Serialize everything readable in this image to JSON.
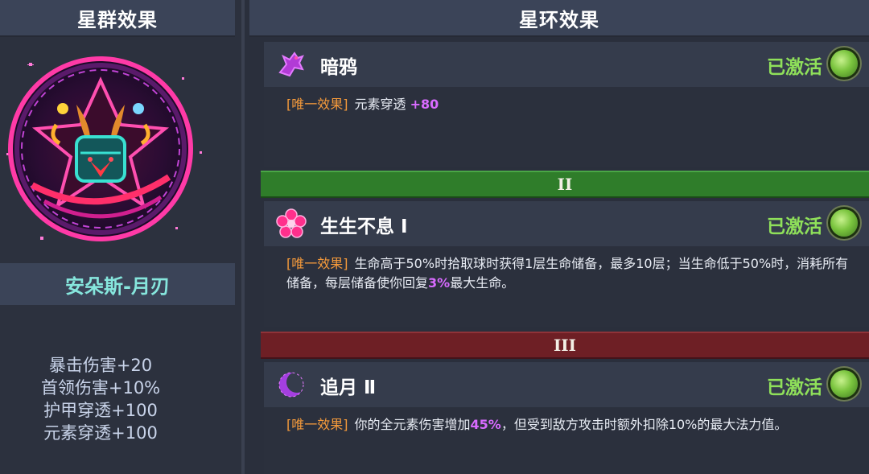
{
  "left_panel": {
    "header": "星群效果",
    "constellation_name": "安朵斯-月刃",
    "stats": [
      "暴击伤害+20",
      "首领伤害+10%",
      "护甲穿透+100",
      "元素穿透+100"
    ]
  },
  "right_panel": {
    "header": "星环效果",
    "entries": [
      {
        "icon": "crow-icon",
        "title": "暗鸦",
        "status": "已激活",
        "tag": "[唯一效果]",
        "desc_pre": "元素穿透",
        "highlight": "+80",
        "desc_post": ""
      },
      {
        "icon": "flower-icon",
        "title": "生生不息 Ⅰ",
        "status": "已激活",
        "tag": "[唯一效果]",
        "desc_pre": "生命高于50%时拾取球时获得1层生命储备，最多10层；当生命低于50%时，消耗所有储备，每层储备使你回复",
        "highlight": "3%",
        "desc_post": "最大生命。"
      },
      {
        "icon": "crescent-moon-icon",
        "title": "追月 Ⅱ",
        "status": "已激活",
        "tag": "[唯一效果]",
        "desc_pre": "你的全元素伤害增加",
        "highlight": "45%",
        "desc_post": "，但受到敌方攻击时额外扣除10%的最大法力值。"
      }
    ],
    "tiers": [
      "II",
      "III"
    ]
  },
  "colors": {
    "status_green": "#8fe05a",
    "tag_orange": "#f59a3b",
    "highlight_purple": "#d86bff",
    "name_teal": "#86e6dd",
    "tier2_green": "#2f7d2a",
    "tier3_red": "#6e1f25"
  }
}
